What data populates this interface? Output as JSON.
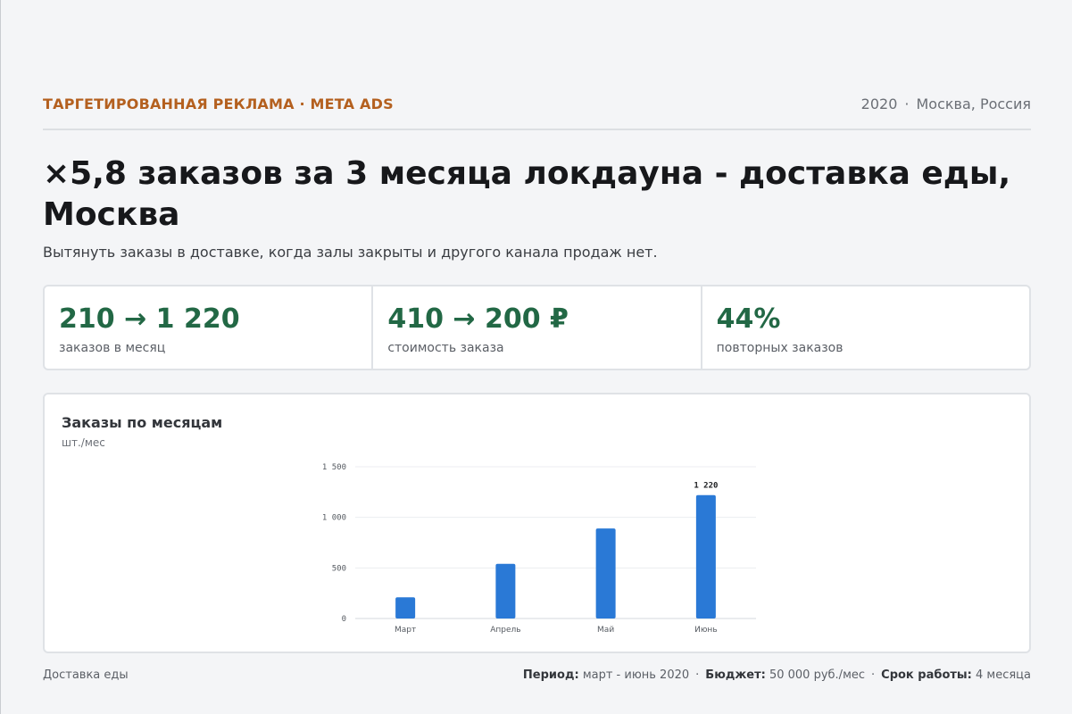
{
  "header": {
    "eyebrow": "ТАРГЕТИРОВАННАЯ РЕКЛАМА · META ADS",
    "year": "2020",
    "location": "Москва, Россия",
    "separator": "·"
  },
  "title": "×5,8 заказов за 3 месяца локдауна - доставка еды, Москва",
  "subtitle": "Вытянуть заказы в доставке, когда залы закрыты и другого канала продаж нет.",
  "stats": [
    {
      "value": "210 → 1 220",
      "label": "заказов в месяц"
    },
    {
      "value": "410 → 200 ₽",
      "label": "стоимость заказа"
    },
    {
      "value": "44%",
      "label": "повторных заказов"
    }
  ],
  "chart_card": {
    "title": "Заказы по месяцам",
    "unit": "шт./мес"
  },
  "chart_data": {
    "type": "bar",
    "title": "Заказы по месяцам",
    "ylabel": "шт./мес",
    "categories": [
      "Март",
      "Апрель",
      "Май",
      "Июнь"
    ],
    "values": [
      210,
      540,
      890,
      1220
    ],
    "ylim": [
      0,
      1500
    ],
    "yticks": [
      0,
      500,
      1000,
      1500
    ],
    "ytick_labels": [
      "0",
      "500",
      "1 000",
      "1 500"
    ],
    "data_labels": [
      null,
      null,
      null,
      "1 220"
    ],
    "grid": true,
    "bar_color": "#2a79d6"
  },
  "footer": {
    "category": "Доставка еды",
    "period_label": "Период:",
    "period_value": "март - июнь 2020",
    "budget_label": "Бюджет:",
    "budget_value": "50 000 руб./мес",
    "term_label": "Срок работы:",
    "term_value": "4 месяца",
    "separator": "·"
  }
}
